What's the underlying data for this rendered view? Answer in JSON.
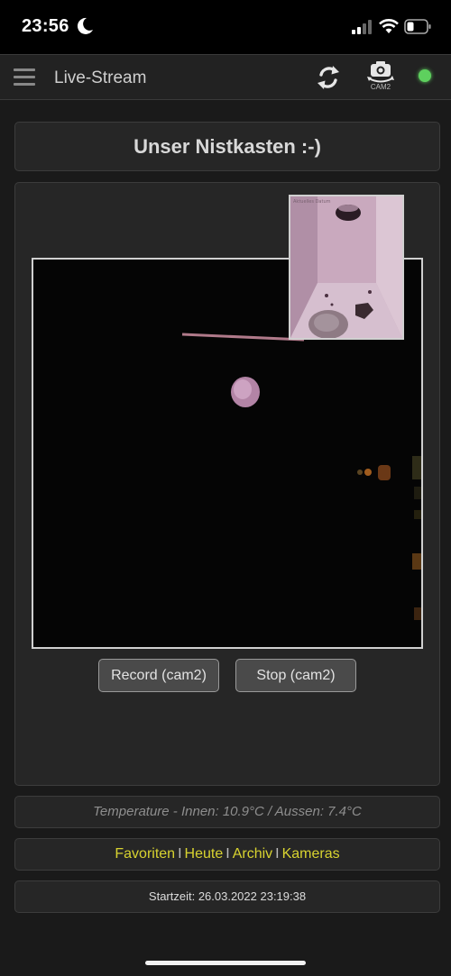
{
  "status_bar": {
    "time": "23:56"
  },
  "nav": {
    "title": "Live-Stream",
    "cam_label": "CAM2"
  },
  "colors": {
    "status_dot": "#5ed05e",
    "link": "#d8d330"
  },
  "main": {
    "title": "Unser Nistkasten :-)",
    "pip_overlay_text": "Aktuelles Datum",
    "buttons": {
      "record": "Record (cam2)",
      "stop": "Stop (cam2)"
    }
  },
  "info": {
    "temperature": "Temperature - Innen: 10.9°C / Aussen: 7.4°C",
    "links": [
      "Favoriten",
      "Heute",
      "Archiv",
      "Kameras"
    ],
    "link_separator": "I",
    "start_time": "Startzeit: 26.03.2022 23:19:38"
  },
  "icons": [
    "menu-icon",
    "refresh-icon",
    "camera-switch-icon",
    "moon-icon",
    "signal-icon",
    "wifi-icon",
    "battery-icon"
  ]
}
